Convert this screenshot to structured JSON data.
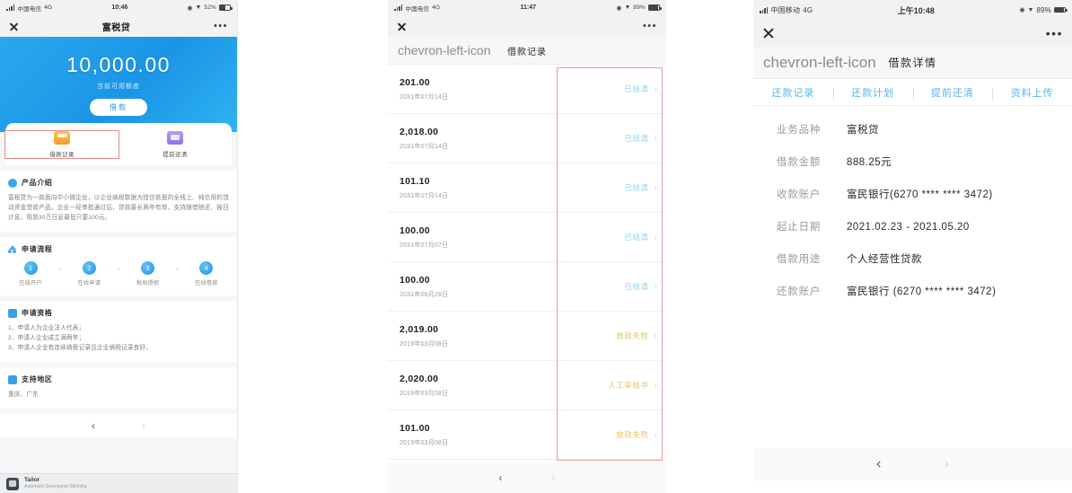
{
  "left_phone": {
    "status_bar": {
      "carrier": "中国电信",
      "network": "4G",
      "time": "10:46",
      "battery": "52%"
    },
    "wechat_bar": {
      "title": "富税贷",
      "close_icon": "close-icon",
      "more_icon": "more-dots-icon"
    },
    "hero": {
      "amount": "10,000.00",
      "subtitle": "当前可用额度",
      "button": "借款"
    },
    "tabs": [
      {
        "label": "借款记录",
        "icon": "records-icon",
        "selected": true
      },
      {
        "label": "提前还清",
        "icon": "repay-icon",
        "selected": false
      }
    ],
    "sections": [
      {
        "title": "产品介绍",
        "icon": "globe-icon",
        "body": "富税贷为一款面向中小微企业，以企业纳税数据为授信依据的全线上、纯信用的流动资金贷款产品。企业一经审批通过后，贷款最长两年有效，支持随借随还、按日计息，用到30万日息最低只要100元。"
      },
      {
        "title": "申请流程",
        "icon": "flow-icon",
        "steps": [
          {
            "num": "1",
            "label": "在线开户"
          },
          {
            "num": "2",
            "label": "在线申请"
          },
          {
            "num": "3",
            "label": "税局授权"
          },
          {
            "num": "4",
            "label": "在线借款"
          }
        ]
      },
      {
        "title": "申请资格",
        "icon": "doc-icon",
        "items": [
          "1、申请人为企业法人代表；",
          "2、申请人企业成立满两年；",
          "3、申请人企业有连续纳税记录且企业纳税记录良好。"
        ]
      },
      {
        "title": "支持地区",
        "icon": "doc-icon",
        "body": "重庆、广东"
      }
    ],
    "pager": {
      "prev": "‹",
      "next": "›"
    },
    "watermark": {
      "name": "Tailor",
      "subtitle": "Automatic Screenshot Stitching"
    }
  },
  "middle_phone": {
    "status_bar": {
      "carrier": "中国电信",
      "network": "4G",
      "time": "11:47",
      "battery": "89%"
    },
    "wechat_bar": {
      "close_icon": "close-icon",
      "more_icon": "more-dots-icon"
    },
    "navbar": {
      "back_icon": "chevron-left-icon",
      "title": "借款记录"
    },
    "rows": [
      {
        "amount": "201.00",
        "date": "2031年07月14日",
        "status": "已结清",
        "status_type": "blue"
      },
      {
        "amount": "2,018.00",
        "date": "2031年07月14日",
        "status": "已结清",
        "status_type": "blue"
      },
      {
        "amount": "101.10",
        "date": "2031年07月14日",
        "status": "已结清",
        "status_type": "blue"
      },
      {
        "amount": "100.00",
        "date": "2031年07月07日",
        "status": "已结清",
        "status_type": "blue"
      },
      {
        "amount": "100.00",
        "date": "2031年06月28日",
        "status": "已结清",
        "status_type": "blue"
      },
      {
        "amount": "2,019.00",
        "date": "2019年03月08日",
        "status": "放款失败",
        "status_type": "gold"
      },
      {
        "amount": "2,020.00",
        "date": "2019年03月08日",
        "status": "人工审核中",
        "status_type": "gold"
      },
      {
        "amount": "101.00",
        "date": "2019年03月08日",
        "status": "放款失败",
        "status_type": "gold"
      }
    ],
    "pager": {
      "prev": "‹",
      "next": "›"
    },
    "highlight_color": "#ef9a9a"
  },
  "right_phone": {
    "status_bar": {
      "carrier": "中国移动",
      "network": "4G",
      "time": "上午10:48",
      "battery": "89%"
    },
    "wechat_bar": {
      "close_icon": "close-icon",
      "more_icon": "more-dots-icon"
    },
    "navbar": {
      "back_icon": "chevron-left-icon",
      "title": "借款详情"
    },
    "tabs": [
      {
        "label": "还款记录"
      },
      {
        "label": "还款计划"
      },
      {
        "label": "提前还清"
      },
      {
        "label": "资料上传"
      }
    ],
    "details": [
      {
        "label": "业务品种",
        "value": "富税贷"
      },
      {
        "label": "借款金额",
        "value": "888.25元"
      },
      {
        "label": "收款账户",
        "value": "富民银行(6270 **** **** 3472)"
      },
      {
        "label": "起止日期",
        "value": "2021.02.23 - 2021.05.20"
      },
      {
        "label": "借款用途",
        "value": "个人经营性贷款"
      },
      {
        "label": "还款账户",
        "value": "富民银行 (6270 **** **** 3472)"
      }
    ],
    "pager": {
      "prev": "‹",
      "next": "›"
    }
  },
  "colors": {
    "hero_blue": "#1f96e6",
    "status_blue": "#8fd2f2",
    "status_gold": "#e8c06a",
    "highlight_red": "#ef9a9a",
    "tab_link_blue": "#56b7e8"
  }
}
